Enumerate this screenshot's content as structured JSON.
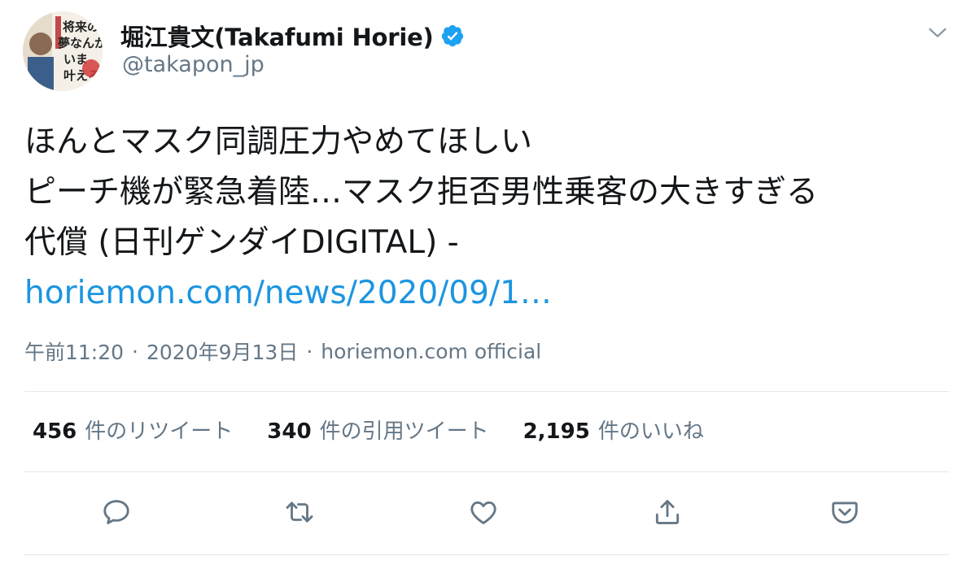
{
  "user": {
    "display_name": "堀江貴文(Takafumi Horie)",
    "handle": "@takapon_jp",
    "avatar_text": "将来の夢なんか、いま叶えろ",
    "verified": true
  },
  "tweet": {
    "lines": [
      "ほんとマスク同調圧力やめてほしい",
      "ピーチ機が緊急着陸…マスク拒否男性乗客の大きすぎる",
      "代償 (日刊ゲンダイDIGITAL) -"
    ],
    "link_text": "horiemon.com/news/2020/09/1…"
  },
  "meta": {
    "time": "午前11:20",
    "date": "2020年9月13日",
    "separator": "·",
    "source": "horiemon.com official"
  },
  "stats": {
    "retweets": {
      "count": "456",
      "label": "件のリツイート"
    },
    "quotes": {
      "count": "340",
      "label": "件の引用ツイート"
    },
    "likes": {
      "count": "2,195",
      "label": "件のいいね"
    }
  },
  "actions": {
    "reply": "reply-icon",
    "retweet": "retweet-icon",
    "like": "heart-icon",
    "share": "share-icon",
    "save": "pocket-icon"
  },
  "colors": {
    "link": "#1b95e0",
    "verified": "#1da1f2",
    "secondary_text": "#657786",
    "icon": "#657786",
    "divider": "#e1e8ed"
  }
}
